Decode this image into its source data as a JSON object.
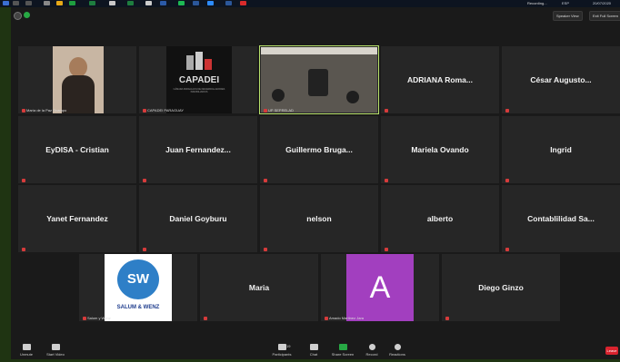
{
  "taskbar": {
    "clock": "20/07/2020",
    "lang": "ESP"
  },
  "window": {
    "speaker_view": "Speaker View",
    "exit_full_screen": "Exit Full Screen",
    "recording": "Recording..."
  },
  "tiles": [
    {
      "name": "",
      "label": "María de la Paz Ocampo",
      "kind": "video-person"
    },
    {
      "name": "",
      "label": "CAPADEI PARAGUAY",
      "kind": "logo-capadei"
    },
    {
      "name": "",
      "label": "UP SEPRELAD",
      "kind": "video-room"
    },
    {
      "name": "ADRIANA  Roma...",
      "label": "",
      "kind": "name"
    },
    {
      "name": "César  Augusto...",
      "label": "",
      "kind": "name"
    },
    {
      "name": "EyDISA - Cristian",
      "label": "",
      "kind": "name"
    },
    {
      "name": "Juan  Fernandez...",
      "label": "",
      "kind": "name"
    },
    {
      "name": "Guillermo  Bruga...",
      "label": "",
      "kind": "name"
    },
    {
      "name": "Mariela Ovando",
      "label": "",
      "kind": "name"
    },
    {
      "name": "Ingrid",
      "label": "",
      "kind": "name"
    },
    {
      "name": "Yanet Fernandez",
      "label": "",
      "kind": "name"
    },
    {
      "name": "Daniel Goyburu",
      "label": "",
      "kind": "name"
    },
    {
      "name": "nelson",
      "label": "",
      "kind": "name"
    },
    {
      "name": "alberto",
      "label": "",
      "kind": "name"
    },
    {
      "name": "Contablilidad  Sa...",
      "label": "",
      "kind": "name"
    },
    {
      "name": "",
      "label": "Salum y Wenz",
      "kind": "logo-salum"
    },
    {
      "name": "Maria",
      "label": "",
      "kind": "name"
    },
    {
      "name": "",
      "label": "Amado Martinez Jara",
      "kind": "avatar-a"
    },
    {
      "name": "Diego Ginzo",
      "label": "",
      "kind": "name"
    }
  ],
  "logos": {
    "capadei": "CAPADEI",
    "capadei_sub": "CÁMARA PARAGUAYA DE DESARROLLADORES INMOBILIARIOS",
    "salum_sw": "SW",
    "salum_text": "SALUM & WENZ",
    "avatar_letter": "A"
  },
  "toolbar": {
    "unmute": "Unmute",
    "start_video": "Start Video",
    "participants": "Participants",
    "participants_count": "19",
    "chat": "Chat",
    "share_screen": "Share Screen",
    "record": "Record",
    "reactions": "Reactions",
    "leave": "Leave"
  },
  "colors": {
    "accent_green": "#b8e16a",
    "share_green": "#27a844",
    "leave_red": "#d9232e",
    "avatar_purple": "#a23fbf"
  }
}
